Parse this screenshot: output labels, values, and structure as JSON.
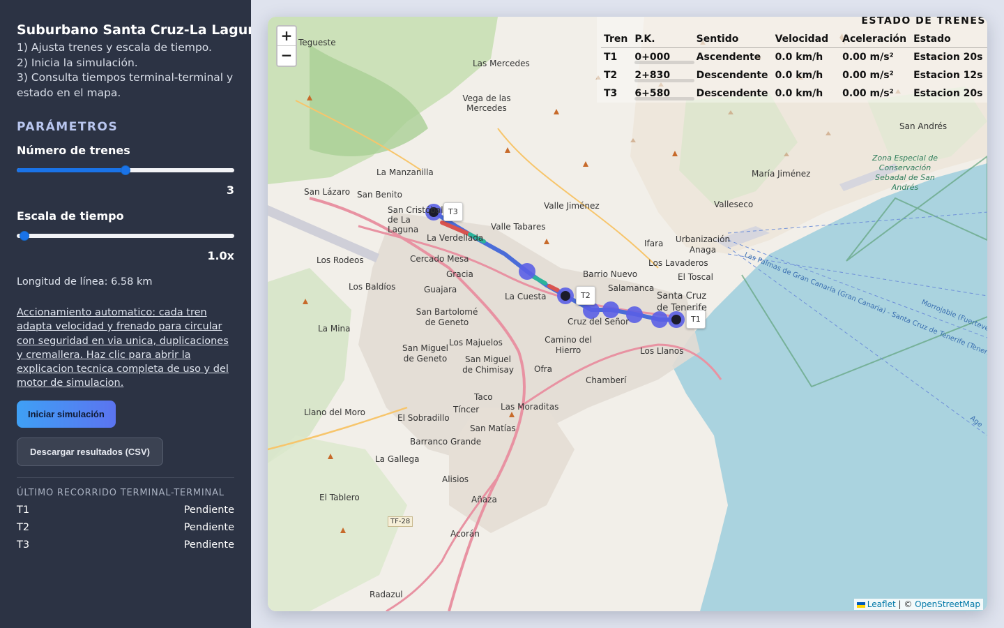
{
  "sidebar": {
    "title": "Suburbano Santa Cruz-La Laguna",
    "instructions": [
      "1) Ajusta trenes y escala de tiempo.",
      "2) Inicia la simulación.",
      "3) Consulta tiempos terminal-terminal y estado en el mapa."
    ],
    "params_title": "PARÁMETROS",
    "trains_label": "Número de trenes",
    "trains_value": "3",
    "trains_slider_fraction": 0.5,
    "scale_label": "Escala de tiempo",
    "scale_value": "1.0x",
    "scale_slider_fraction": 0.0,
    "line_length": "Longitud de línea: 6.58 km",
    "tech_link": "Accionamiento automatico: cada tren adapta velocidad y frenado para circular con seguridad en via unica, duplicaciones y cremallera. Haz clic para abrir la explicacion tecnica completa de uso y del motor de simulacion.",
    "start_button": "Iniciar simulación",
    "download_button": "Descargar resultados (CSV)",
    "trips_title": "ÚLTIMO RECORRIDO TERMINAL-TERMINAL",
    "trips": [
      {
        "train": "T1",
        "status": "Pendiente"
      },
      {
        "train": "T2",
        "status": "Pendiente"
      },
      {
        "train": "T3",
        "status": "Pendiente"
      }
    ]
  },
  "map": {
    "zoom_in": "+",
    "zoom_out": "−",
    "train_labels": [
      "T3",
      "T2",
      "T1"
    ],
    "places": {
      "tegueste": "Tegueste",
      "las_mercedes": "Las Mercedes",
      "vega_mercedes": "Vega de las Mercedes",
      "la_manzanilla": "La Manzanilla",
      "san_lazaro": "San Lázaro",
      "san_benito": "San Benito",
      "la_laguna": "San Cristóbal de La Laguna",
      "valle_jimenez": "Valle Jiménez",
      "valle_tabares": "Valle Tabares",
      "la_verdellada": "La Verdellada",
      "cercado_mesa": "Cercado Mesa",
      "los_rodeos": "Los Rodeos",
      "los_baldios": "Los Baldíos",
      "guajara": "Guajara",
      "gracia": "Gracia",
      "la_cuesta": "La Cuesta",
      "barrio_nuevo": "Barrio Nuevo",
      "salamanca": "Salamanca",
      "santa_cruz": "Santa Cruz de Tenerife",
      "cruz_senor": "Cruz del Señor",
      "los_llanos": "Los Llanos",
      "camino_hierro": "Camino del Hierro",
      "chamberi": "Chamberí",
      "taco": "Taco",
      "las_moraditas": "Las Moraditas",
      "la_mina": "La Mina",
      "san_miguel_geneto": "San Miguel de Geneto",
      "san_miguel_chimisay": "San Miguel de Chimisay",
      "los_majuelos": "Los Majuelos",
      "ofra": "Ofra",
      "tincer": "Tíncer",
      "el_sobradillo": "El Sobradillo",
      "llano_moro": "Llano del Moro",
      "san_matias": "San Matías",
      "barranco_grande": "Barranco Grande",
      "la_gallega": "La Gallega",
      "alisios": "Alisios",
      "el_tablero": "El Tablero",
      "anaza": "Añaza",
      "acoran": "Acorán",
      "radazul": "Radazul",
      "valleseco": "Valleseco",
      "maria_jimenez": "María Jiménez",
      "san_andres": "San Andrés",
      "urbanizacion_anaga": "Urbanización Anaga",
      "ifara": "Ifara",
      "los_lavaderos": "Los Lavaderos",
      "el_toscal": "El Toscal",
      "san_bartolome": "San Bartolomé de Geneto",
      "zona_especial": "Zona Especial de Conservación Sebadal de San Andrés",
      "ferry_1": "Las Palmas de Gran Canaria (Gran Canaria) - Santa Cruz de Tenerife (Tenerife)",
      "ferry_2": "Morrojable (Fuerteve",
      "ferry_3": "Age",
      "tf28": "TF-28"
    },
    "attribution_leaflet": "Leaflet",
    "attribution_sep": " | © ",
    "attribution_osm": "OpenStreetMap"
  },
  "status_panel": {
    "title": "ESTADO DE TRENES",
    "headers": [
      "Tren",
      "P.K.",
      "Sentido",
      "Velocidad",
      "Aceleración",
      "Estado"
    ],
    "rows": [
      {
        "train": "T1",
        "pk": "0+000",
        "direction": "Ascendente",
        "speed": "0.0 km/h",
        "accel": "0.00 m/s²",
        "state": "Estacion 20s"
      },
      {
        "train": "T2",
        "pk": "2+830",
        "direction": "Descendente",
        "speed": "0.0 km/h",
        "accel": "0.00 m/s²",
        "state": "Estacion 12s"
      },
      {
        "train": "T3",
        "pk": "6+580",
        "direction": "Descendente",
        "speed": "0.0 km/h",
        "accel": "0.00 m/s²",
        "state": "Estacion 20s"
      }
    ]
  },
  "colors": {
    "sidebar_bg": "#2c3344",
    "accent": "#1a73e8",
    "route_line": "#4a6cd8",
    "station": "#5a5fe6",
    "sea": "#aad3df"
  }
}
